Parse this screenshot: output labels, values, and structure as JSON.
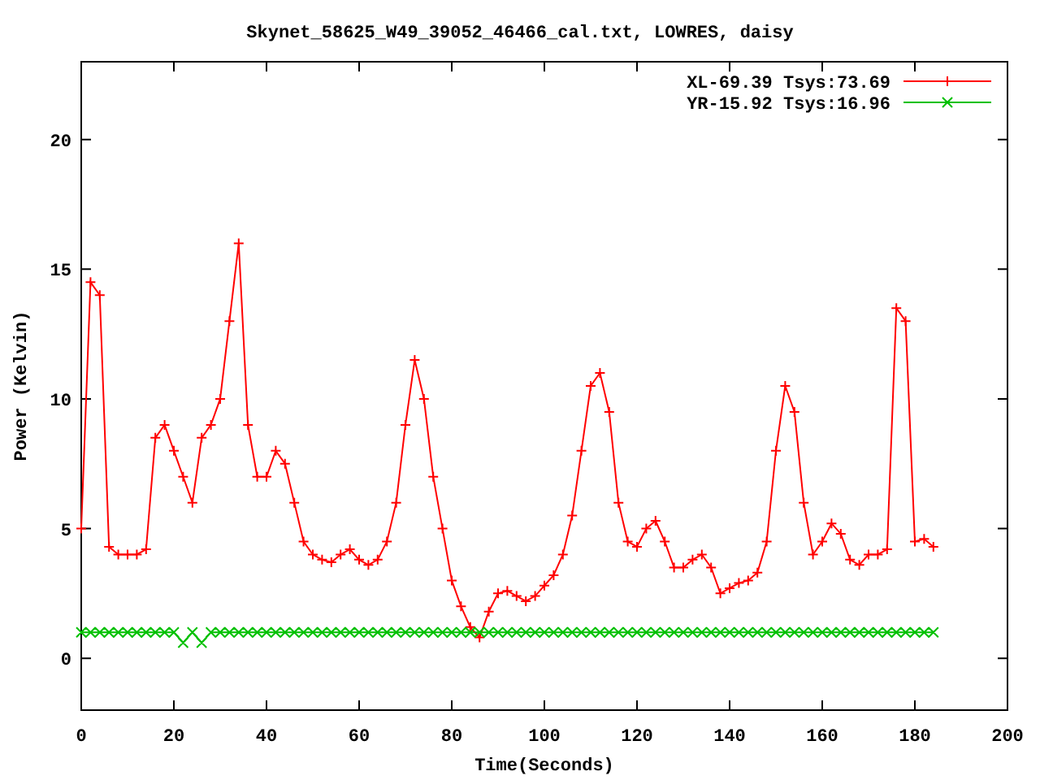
{
  "chart_data": {
    "type": "line",
    "title": "Skynet_58625_W49_39052_46466_cal.txt, LOWRES, daisy",
    "xlabel": "Time(Seconds)",
    "ylabel": "Power (Kelvin)",
    "xlim": [
      0,
      200
    ],
    "ylim": [
      -2,
      23
    ],
    "legend": true,
    "xticks": [
      0,
      20,
      40,
      60,
      80,
      100,
      120,
      140,
      160,
      180,
      200
    ],
    "yticks": [
      0,
      5,
      10,
      15,
      20
    ],
    "x": [
      0,
      2,
      4,
      6,
      8,
      10,
      12,
      14,
      16,
      18,
      20,
      22,
      24,
      26,
      28,
      30,
      32,
      34,
      36,
      38,
      40,
      42,
      44,
      46,
      48,
      50,
      52,
      54,
      56,
      58,
      60,
      62,
      64,
      66,
      68,
      70,
      72,
      74,
      76,
      78,
      80,
      82,
      84,
      86,
      88,
      90,
      92,
      94,
      96,
      98,
      100,
      102,
      104,
      106,
      108,
      110,
      112,
      114,
      116,
      118,
      120,
      122,
      124,
      126,
      128,
      130,
      132,
      134,
      136,
      138,
      140,
      142,
      144,
      146,
      148,
      150,
      152,
      154,
      156,
      158,
      160,
      162,
      164,
      166,
      168,
      170,
      172,
      174,
      176,
      178,
      180,
      182,
      184
    ],
    "series": [
      {
        "name": "XL-69.39 Tsys:73.69",
        "color": "#ff0000",
        "marker": "plus",
        "values": [
          5,
          14.5,
          14,
          4.3,
          4,
          4,
          4,
          4.2,
          8.5,
          9,
          8,
          7,
          6,
          8.5,
          9,
          10,
          13,
          16,
          9,
          7,
          7,
          8,
          7.5,
          6,
          4.5,
          4,
          3.8,
          3.7,
          4,
          4.2,
          3.8,
          3.6,
          3.8,
          4.5,
          6,
          9,
          11.5,
          10,
          7,
          5,
          3,
          2,
          1.2,
          0.8,
          1.8,
          2.5,
          2.6,
          2.4,
          2.2,
          2.4,
          2.8,
          3.2,
          4,
          5.5,
          8,
          10.5,
          11,
          9.5,
          6,
          4.5,
          4.3,
          5,
          5.3,
          4.5,
          3.5,
          3.5,
          3.8,
          4,
          3.5,
          2.5,
          2.7,
          2.9,
          3,
          3.3,
          4.5,
          8,
          10.5,
          9.5,
          6,
          4,
          4.5,
          5.2,
          4.8,
          3.8,
          3.6,
          4,
          4,
          4.2,
          13.5,
          13,
          4.5,
          4.6,
          4.3
        ]
      },
      {
        "name": "YR-15.92 Tsys:16.96",
        "color": "#00c000",
        "marker": "cross",
        "values": [
          1,
          1,
          1,
          1,
          1,
          1,
          1,
          1,
          1,
          1,
          1,
          0.6,
          1,
          0.6,
          1,
          1,
          1,
          1,
          1,
          1,
          1,
          1,
          1,
          1,
          1,
          1,
          1,
          1,
          1,
          1,
          1,
          1,
          1,
          1,
          1,
          1,
          1,
          1,
          1,
          1,
          1,
          1,
          1,
          1,
          1,
          1,
          1,
          1,
          1,
          1,
          1,
          1,
          1,
          1,
          1,
          1,
          1,
          1,
          1,
          1,
          1,
          1,
          1,
          1,
          1,
          1,
          1,
          1,
          1,
          1,
          1,
          1,
          1,
          1,
          1,
          1,
          1,
          1,
          1,
          1,
          1,
          1,
          1,
          1,
          1,
          1,
          1,
          1,
          1,
          1,
          1,
          1,
          1
        ]
      }
    ]
  }
}
